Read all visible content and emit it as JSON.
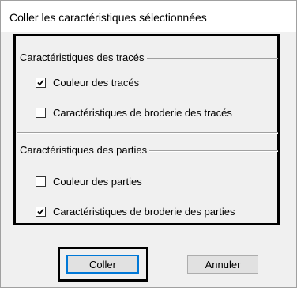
{
  "dialog": {
    "title": "Coller les caractéristiques sélectionnées"
  },
  "groups": [
    {
      "header": "Caractéristiques des tracés",
      "options": [
        {
          "label": "Couleur des tracés",
          "checked": true
        },
        {
          "label": "Caractéristiques de broderie des tracés",
          "checked": false
        }
      ]
    },
    {
      "header": "Caractéristiques des parties",
      "options": [
        {
          "label": "Couleur des parties",
          "checked": false
        },
        {
          "label": "Caractéristiques de broderie des parties",
          "checked": true
        }
      ]
    }
  ],
  "buttons": {
    "ok_label": "Coller",
    "cancel_label": "Annuler"
  }
}
